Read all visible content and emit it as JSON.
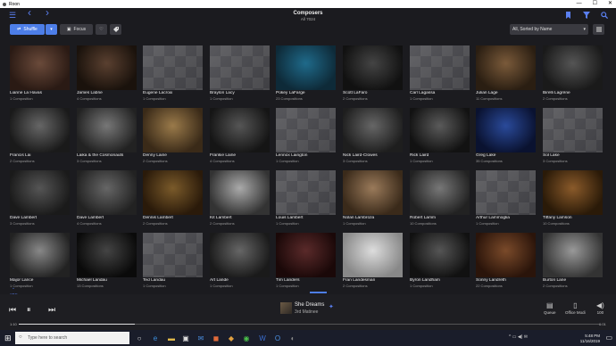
{
  "window": {
    "title": "Roon",
    "minimize": "—",
    "maximize": "☐",
    "close": "✕"
  },
  "header": {
    "title": "Composers",
    "subtitle": "All 7024"
  },
  "toolbar": {
    "shuffle": "Shuffle",
    "focus": "Focus",
    "sort": "All, Sorted by Name"
  },
  "icons": {
    "menu": "☰",
    "back": "‹",
    "forward": "›",
    "bookmark": "bookmark-icon",
    "filter": "filter-icon",
    "search": "search-icon",
    "shuffle": "⇄",
    "caret": "▾",
    "heart": "♡",
    "tag": "tag-icon",
    "list": "list-icon",
    "focus": "▣"
  },
  "colors": {
    "accent": "#4d7ee8",
    "background": "#1b1b1f"
  },
  "composers": [
    {
      "name": "Lianne La Havas",
      "count": "1 Composition",
      "img": "photo"
    },
    {
      "name": "James Labrie",
      "count": "4 Compositions",
      "img": "photo"
    },
    {
      "name": "Eugene Lacroix",
      "count": "1 Composition",
      "img": "placeholder"
    },
    {
      "name": "Braylon Lacy",
      "count": "1 Composition",
      "img": "placeholder"
    },
    {
      "name": "Pokey LaFarge",
      "count": "23 Compositions",
      "img": "photo"
    },
    {
      "name": "Scott LaFaro",
      "count": "2 Compositions",
      "img": "photo"
    },
    {
      "name": "Carl Lagassa",
      "count": "1 Composition",
      "img": "placeholder"
    },
    {
      "name": "Julian Lage",
      "count": "11 Compositions",
      "img": "photo"
    },
    {
      "name": "Birelli Lagrène",
      "count": "2 Compositions",
      "img": "photo"
    },
    {
      "name": "Francis Lai",
      "count": "2 Compositions",
      "img": "photo"
    },
    {
      "name": "Laika & the Cosmonauts",
      "count": "3 Compositions",
      "img": "photo"
    },
    {
      "name": "Denny Laine",
      "count": "2 Compositions",
      "img": "photo"
    },
    {
      "name": "Frankie Laine",
      "count": "4 Compositions",
      "img": "photo"
    },
    {
      "name": "Lennox Laington",
      "count": "1 Composition",
      "img": "placeholder"
    },
    {
      "name": "Nick Laird-Clowes",
      "count": "3 Compositions",
      "img": "photo"
    },
    {
      "name": "Rick Laird",
      "count": "1 Composition",
      "img": "photo"
    },
    {
      "name": "Greg Lake",
      "count": "35 Compositions",
      "img": "photo"
    },
    {
      "name": "Sol Lake",
      "count": "3 Compositions",
      "img": "placeholder"
    },
    {
      "name": "Dave Lambert",
      "count": "3 Compositions",
      "img": "photo"
    },
    {
      "name": "Dave Lambert",
      "count": "4 Compositions",
      "img": "photo"
    },
    {
      "name": "Dennis Lambert",
      "count": "2 Compositions",
      "img": "photo"
    },
    {
      "name": "Kit Lambert",
      "count": "2 Compositions",
      "img": "photo"
    },
    {
      "name": "Louis Lambert",
      "count": "1 Composition",
      "img": "placeholder"
    },
    {
      "name": "Nolan Lambroza",
      "count": "1 Composition",
      "img": "photo"
    },
    {
      "name": "Robert Lamm",
      "count": "10 Compositions",
      "img": "photo"
    },
    {
      "name": "Arthur Lammoglia",
      "count": "1 Composition",
      "img": "placeholder"
    },
    {
      "name": "Tiffany Lamson",
      "count": "10 Compositions",
      "img": "photo"
    },
    {
      "name": "Major Lance",
      "count": "1 Composition",
      "img": "photo"
    },
    {
      "name": "Michael Landau",
      "count": "13 Compositions",
      "img": "photo"
    },
    {
      "name": "Ted Landau",
      "count": "1 Composition",
      "img": "placeholder"
    },
    {
      "name": "Art Lande",
      "count": "1 Composition",
      "img": "photo"
    },
    {
      "name": "Tim Landers",
      "count": "1 Composition",
      "img": "photo"
    },
    {
      "name": "Fran Landesman",
      "count": "2 Compositions",
      "img": "photo"
    },
    {
      "name": "Byron Landham",
      "count": "1 Composition",
      "img": "photo"
    },
    {
      "name": "Sonny Landreth",
      "count": "22 Compositions",
      "img": "photo"
    },
    {
      "name": "Burton Lane",
      "count": "2 Compositions",
      "img": "photo"
    }
  ],
  "alpha_index": {
    "arrow": "⌃",
    "label": "ABC"
  },
  "player": {
    "prev": "⏮",
    "pause": "⏸",
    "next": "⏭",
    "track_title": "She Dreams",
    "track_subtitle": "3rd Matinee",
    "elapsed": "1:10",
    "remaining": "6:01",
    "progress": 0.2,
    "queue_label": "Queue",
    "zone_label": "Office Modi",
    "volume_label": "100",
    "queue_icon": "queue-icon",
    "zone_icon": "speaker-icon",
    "volume_icon": "volume-icon"
  },
  "taskbar": {
    "search_placeholder": "Type here to search",
    "time": "5:48 PM",
    "date": "11/16/2019"
  }
}
